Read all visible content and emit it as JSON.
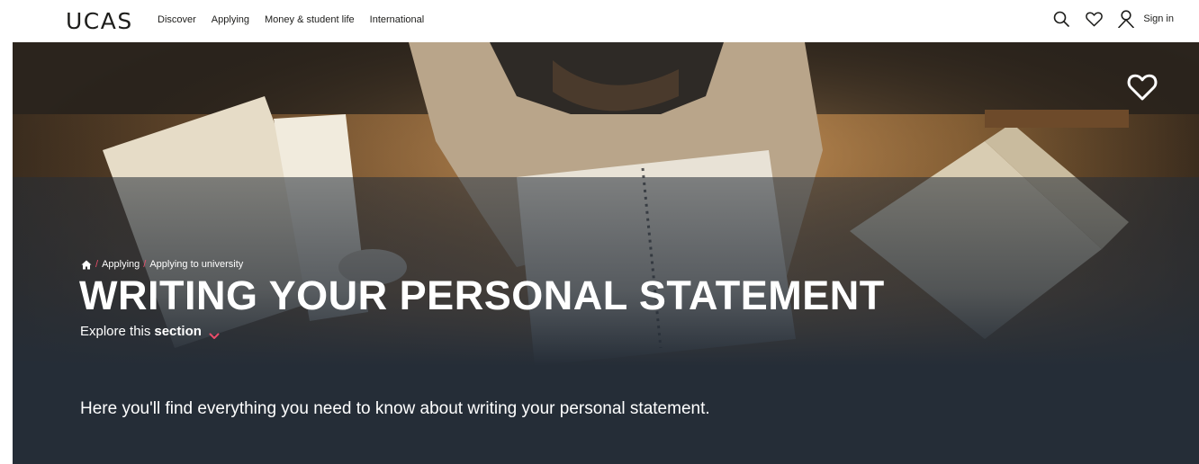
{
  "header": {
    "logo": "UCAS",
    "nav": [
      "Discover",
      "Applying",
      "Money & student life",
      "International"
    ],
    "signin_label": "Sign in",
    "icons": [
      "search-icon",
      "heart-icon",
      "user-icon"
    ]
  },
  "hero": {
    "breadcrumb": [
      "Applying",
      "Applying to university"
    ],
    "title": "WRITING YOUR PERSONAL STATEMENT",
    "explore_prefix": "Explore this",
    "explore_bold": "section",
    "intro": "Here you'll find everything you need to know about writing your personal statement."
  },
  "colors": {
    "hero_bg": "#252d37",
    "accent": "#e94d6a",
    "text_dark": "#1d1d1b"
  }
}
